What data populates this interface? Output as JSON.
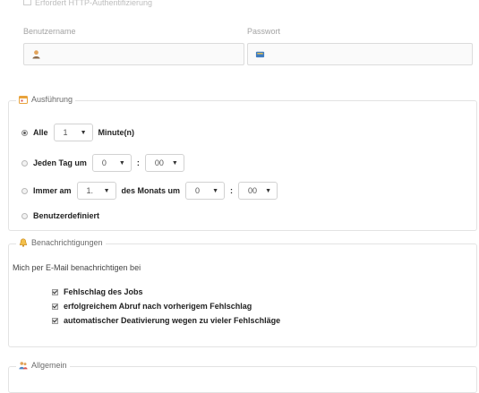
{
  "top": {
    "legend": "Erfordert HTTP-Authentifizierung",
    "username_label": "Benutzername",
    "password_label": "Passwort",
    "username_value": "",
    "password_value": ""
  },
  "execution": {
    "legend": "Ausführung",
    "every": {
      "label": "Alle",
      "value": "1",
      "unit": "Minute(n)"
    },
    "daily": {
      "label": "Jeden Tag um",
      "hour": "0",
      "sep": ":",
      "minute": "00"
    },
    "monthly": {
      "label": "Immer am",
      "day": "1.",
      "middle": "des Monats um",
      "hour": "0",
      "sep": ":",
      "minute": "00"
    },
    "custom": {
      "label": "Benutzerdefiniert"
    },
    "selected": "every"
  },
  "notifications": {
    "legend": "Benachrichtigungen",
    "intro": "Mich per E-Mail benachrichtigen bei",
    "options": [
      {
        "label": "Fehlschlag des Jobs",
        "checked": true
      },
      {
        "label": "erfolgreichem Abruf nach vorherigem Fehlschlag",
        "checked": true
      },
      {
        "label": "automatischer Deativierung wegen zu vieler Fehlschläge",
        "checked": true
      }
    ]
  },
  "general": {
    "legend": "Allgemein"
  },
  "colors": {
    "border": "#e3e3e3",
    "legend_text": "#6b6b6b",
    "accent_orange": "#e8a33c",
    "calendar_red": "#d9534f"
  }
}
